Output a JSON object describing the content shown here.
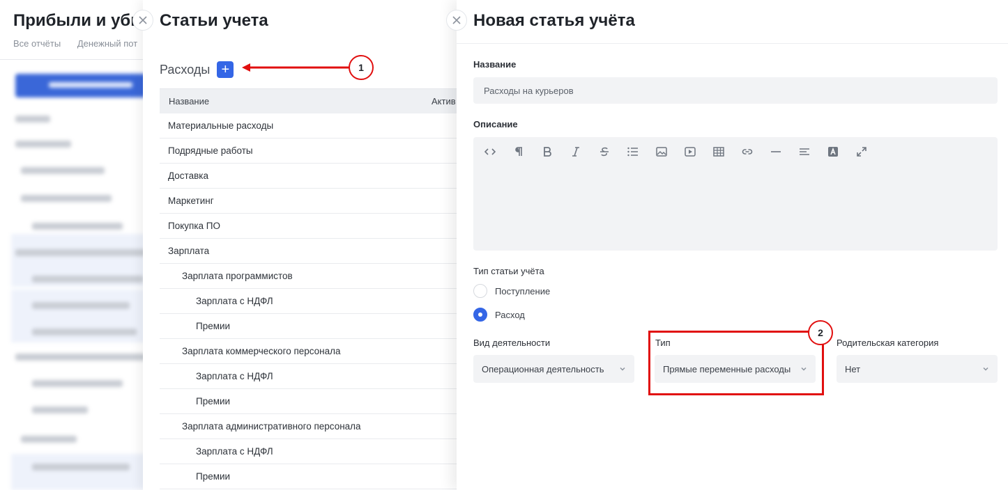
{
  "background_report": {
    "title": "Прибыли и убы",
    "tabs": [
      "Все отчёты",
      "Денежный пот"
    ]
  },
  "accounting_items_panel": {
    "title": "Статьи учета",
    "section_label": "Расходы",
    "add_label": "+",
    "columns": [
      "Название",
      "Актив"
    ],
    "rows": [
      {
        "name": "Материальные расходы",
        "level": 0
      },
      {
        "name": "Подрядные работы",
        "level": 0
      },
      {
        "name": "Доставка",
        "level": 0
      },
      {
        "name": "Маркетинг",
        "level": 0
      },
      {
        "name": "Покупка ПО",
        "level": 0
      },
      {
        "name": "Зарплата",
        "level": 0
      },
      {
        "name": "Зарплата программистов",
        "level": 1
      },
      {
        "name": "Зарплата с НДФЛ",
        "level": 2
      },
      {
        "name": "Премии",
        "level": 2
      },
      {
        "name": "Зарплата коммерческого персонала",
        "level": 1
      },
      {
        "name": "Зарплата с НДФЛ",
        "level": 2
      },
      {
        "name": "Премии",
        "level": 2
      },
      {
        "name": "Зарплата административного персонала",
        "level": 1
      },
      {
        "name": "Зарплата с НДФЛ",
        "level": 2
      },
      {
        "name": "Премии",
        "level": 2
      }
    ]
  },
  "new_item_panel": {
    "title": "Новая статья учёта",
    "name_label": "Название",
    "name_value": "Расходы на курьеров",
    "description_label": "Описание",
    "toolbar_icons": [
      "code-icon",
      "paragraph-icon",
      "bold-icon",
      "italic-icon",
      "strikethrough-icon",
      "list-icon",
      "image-icon",
      "video-icon",
      "table-icon",
      "link-icon",
      "horizontal-rule-icon",
      "align-icon",
      "text-color-icon",
      "fullscreen-icon"
    ],
    "type_label": "Тип статьи учёта",
    "type_options": [
      {
        "label": "Поступление",
        "selected": false
      },
      {
        "label": "Расход",
        "selected": true
      }
    ],
    "activity_label": "Вид деятельности",
    "activity_value": "Операционная деятельность",
    "kind_label": "Тип",
    "kind_value": "Прямые переменные расходы",
    "parent_label": "Родительская категория",
    "parent_value": "Нет"
  },
  "callouts": [
    "1",
    "2"
  ],
  "colors": {
    "accent": "#3466e6",
    "callout": "#e10f0f"
  }
}
